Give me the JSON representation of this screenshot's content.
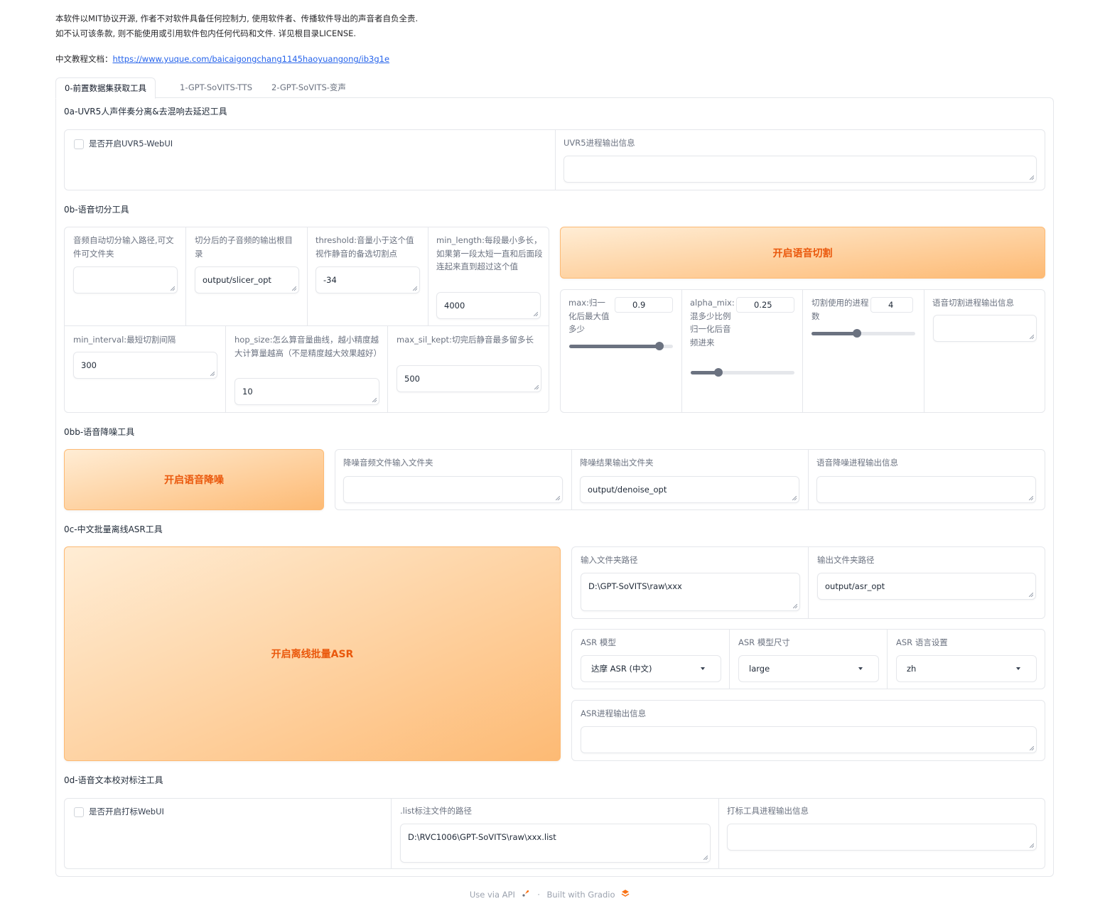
{
  "notice": {
    "line1": "本软件以MIT协议开源, 作者不对软件具备任何控制力, 使用软件者、传播软件导出的声音者自负全责.",
    "line2": "如不认可该条款, 则不能使用或引用软件包内任何代码和文件. 详见根目录LICENSE."
  },
  "tutorial": {
    "label": "中文教程文档：",
    "link": "https://www.yuque.com/baicaigongchang1145haoyuangong/ib3g1e"
  },
  "tabs": [
    {
      "label": "0-前置数据集获取工具",
      "active": true
    },
    {
      "label": "1-GPT-SoVITS-TTS",
      "active": false
    },
    {
      "label": "2-GPT-SoVITS-变声",
      "active": false
    }
  ],
  "uvr5": {
    "title": "0a-UVR5人声伴奏分离&去混响去延迟工具",
    "checkbox_label": "是否开启UVR5-WebUI",
    "output_label": "UVR5进程输出信息",
    "output_value": ""
  },
  "slicer": {
    "title": "0b-语音切分工具",
    "input_path_label": "音频自动切分输入路径,可文件可文件夹",
    "input_path_value": "",
    "output_dir_label": "切分后的子音频的输出根目录",
    "output_dir_value": "output/slicer_opt",
    "threshold_label": "threshold:音量小于这个值视作静音的备选切割点",
    "threshold_value": "-34",
    "min_length_label": "min_length:每段最小多长，如果第一段太短一直和后面段连起来直到超过这个值",
    "min_length_value": "4000",
    "min_interval_label": "min_interval:最短切割间隔",
    "min_interval_value": "300",
    "hop_size_label": "hop_size:怎么算音量曲线，越小精度越大计算量越高（不是精度越大效果越好）",
    "hop_size_value": "10",
    "max_sil_label": "max_sil_kept:切完后静音最多留多长",
    "max_sil_value": "500",
    "start_button": "开启语音切割",
    "max_label": "max:归一化后最大值多少",
    "max_value": "0.9",
    "max_fraction": 0.87,
    "alpha_label": "alpha_mix:混多少比例归一化后音频进来",
    "alpha_value": "0.25",
    "alpha_fraction": 0.27,
    "procs_label": "切割使用的进程数",
    "procs_value": "4",
    "procs_fraction": 0.44,
    "output_label": "语音切割进程输出信息",
    "output_value": ""
  },
  "denoise": {
    "title": "0bb-语音降噪工具",
    "start_button": "开启语音降噪",
    "input_label": "降噪音频文件输入文件夹",
    "input_value": "",
    "output_dir_label": "降噪结果输出文件夹",
    "output_dir_value": "output/denoise_opt",
    "output_label": "语音降噪进程输出信息",
    "output_value": ""
  },
  "asr": {
    "title": "0c-中文批量离线ASR工具",
    "start_button": "开启离线批量ASR",
    "input_dir_label": "输入文件夹路径",
    "input_dir_value": "D:\\GPT-SoVITS\\raw\\xxx",
    "output_dir_label": "输出文件夹路径",
    "output_dir_value": "output/asr_opt",
    "model_label": "ASR 模型",
    "model_value": "达摩 ASR (中文)",
    "size_label": "ASR 模型尺寸",
    "size_value": "large",
    "lang_label": "ASR 语言设置",
    "lang_value": "zh",
    "output_label": "ASR进程输出信息",
    "output_value": ""
  },
  "labeling": {
    "title": "0d-语音文本校对标注工具",
    "checkbox_label": "是否开启打标WebUI",
    "list_label": ".list标注文件的路径",
    "list_value": "D:\\RVC1006\\GPT-SoVITS\\raw\\xxx.list",
    "output_label": "打标工具进程输出信息",
    "output_value": ""
  },
  "footer": {
    "api": "Use via API",
    "separator": "·",
    "built": "Built with Gradio"
  },
  "colors": {
    "accent": "#ea580c",
    "accent_light": "#ffedd5",
    "accent_mid": "#fdba74",
    "border": "#e5e7eb",
    "link": "#2563eb"
  }
}
